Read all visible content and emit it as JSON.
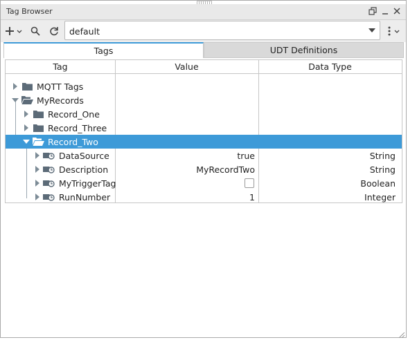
{
  "window": {
    "title": "Tag Browser"
  },
  "toolbar": {
    "provider_value": "default",
    "add_icon": "plus-icon",
    "search_icon": "search-icon",
    "refresh_icon": "refresh-icon",
    "menu_icon": "kebab-menu-icon"
  },
  "tabs": [
    {
      "label": "Tags",
      "active": true
    },
    {
      "label": "UDT Definitions",
      "active": false
    }
  ],
  "columns": [
    "Tag",
    "Value",
    "Data Type"
  ],
  "rows": [
    {
      "label": "MQTT Tags",
      "value": "",
      "type": "",
      "depth": 0,
      "expanded": false,
      "icon": "folder-icon"
    },
    {
      "label": "MyRecords",
      "value": "",
      "type": "",
      "depth": 0,
      "expanded": true,
      "icon": "folder-open-icon"
    },
    {
      "label": "Record_One",
      "value": "",
      "type": "",
      "depth": 1,
      "expanded": false,
      "icon": "folder-icon"
    },
    {
      "label": "Record_Three",
      "value": "",
      "type": "",
      "depth": 1,
      "expanded": false,
      "icon": "folder-icon"
    },
    {
      "label": "Record_Two",
      "value": "",
      "type": "",
      "depth": 1,
      "expanded": true,
      "icon": "folder-open-icon",
      "selected": true
    },
    {
      "label": "DataSource",
      "value": "true",
      "type": "String",
      "depth": 2,
      "expanded": false,
      "icon": "tag-icon"
    },
    {
      "label": "Description",
      "value": "MyRecordTwo",
      "type": "String",
      "depth": 2,
      "expanded": false,
      "icon": "tag-icon"
    },
    {
      "label": "MyTriggerTag",
      "value": "",
      "type": "Boolean",
      "depth": 2,
      "expanded": false,
      "icon": "tag-icon",
      "checkbox": true
    },
    {
      "label": "RunNumber",
      "value": "1",
      "type": "Integer",
      "depth": 2,
      "expanded": false,
      "icon": "tag-icon"
    }
  ],
  "colors": {
    "accent": "#3d9ad8",
    "folder": "#5c6b78",
    "selected_text": "#ffffff"
  }
}
